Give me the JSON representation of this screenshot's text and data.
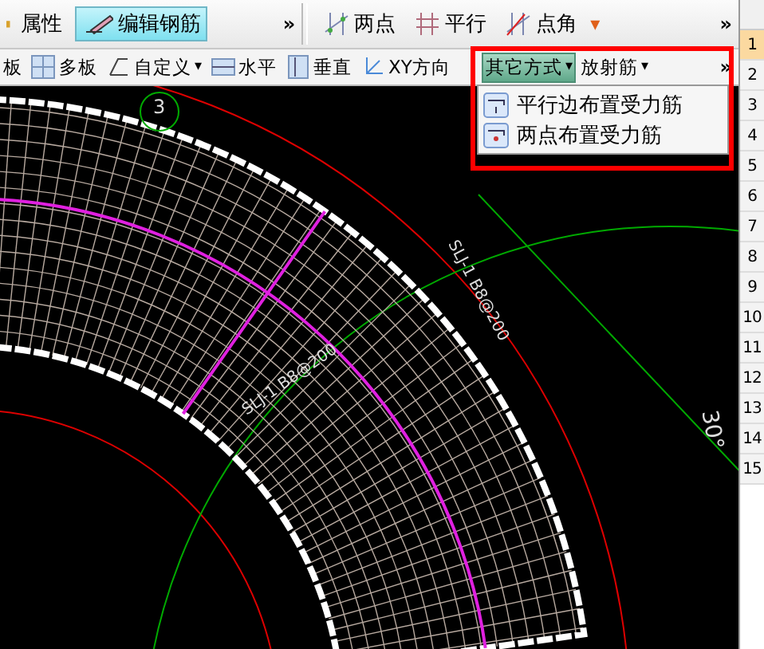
{
  "toolbar_top_left": {
    "items": [
      {
        "label": "属性",
        "pressed": false
      },
      {
        "label": "编辑钢筋",
        "pressed": true
      }
    ],
    "overflow": "»"
  },
  "toolbar_top_right": {
    "items": [
      {
        "label": "两点",
        "pressed": false
      },
      {
        "label": "平行",
        "pressed": false
      },
      {
        "label": "点角",
        "pressed": false
      }
    ],
    "more": "▾",
    "overflow": "»"
  },
  "toolbar_second": {
    "items": [
      {
        "label": "板",
        "pressed": false,
        "dropdown": false
      },
      {
        "label": "多板",
        "pressed": false,
        "dropdown": false
      },
      {
        "label": "自定义",
        "pressed": false,
        "dropdown": true
      },
      {
        "label": "水平",
        "pressed": false,
        "dropdown": false
      },
      {
        "label": "垂直",
        "pressed": false,
        "dropdown": false
      },
      {
        "label": "XY方向",
        "pressed": false,
        "dropdown": false
      },
      {
        "label": "其它方式",
        "pressed": true,
        "dropdown": true
      },
      {
        "label": "放射筋",
        "pressed": false,
        "dropdown": true
      }
    ],
    "caret": "▾",
    "overflow": "»"
  },
  "dropdown_menu": {
    "items": [
      {
        "label": "平行边布置受力筋"
      },
      {
        "label": "两点布置受力筋"
      }
    ]
  },
  "canvas": {
    "labels": [
      {
        "text": "3",
        "kind": "marker"
      },
      {
        "text": "SLJ-1 B8@200",
        "kind": "rebar-a"
      },
      {
        "text": "SLJ-1 B8@200",
        "kind": "rebar-b"
      },
      {
        "text": "30°",
        "kind": "angle"
      }
    ]
  },
  "row_numbers": [
    {
      "label": "1",
      "selected": true
    },
    {
      "label": "2",
      "selected": false
    },
    {
      "label": "3",
      "selected": false
    },
    {
      "label": "4",
      "selected": false
    },
    {
      "label": "5",
      "selected": false
    },
    {
      "label": "6",
      "selected": false
    },
    {
      "label": "7",
      "selected": false
    },
    {
      "label": "8",
      "selected": false
    },
    {
      "label": "9",
      "selected": false
    },
    {
      "label": "10",
      "selected": false
    },
    {
      "label": "11",
      "selected": false
    },
    {
      "label": "12",
      "selected": false
    },
    {
      "label": "13",
      "selected": false
    },
    {
      "label": "14",
      "selected": false
    },
    {
      "label": "15",
      "selected": false
    }
  ]
}
